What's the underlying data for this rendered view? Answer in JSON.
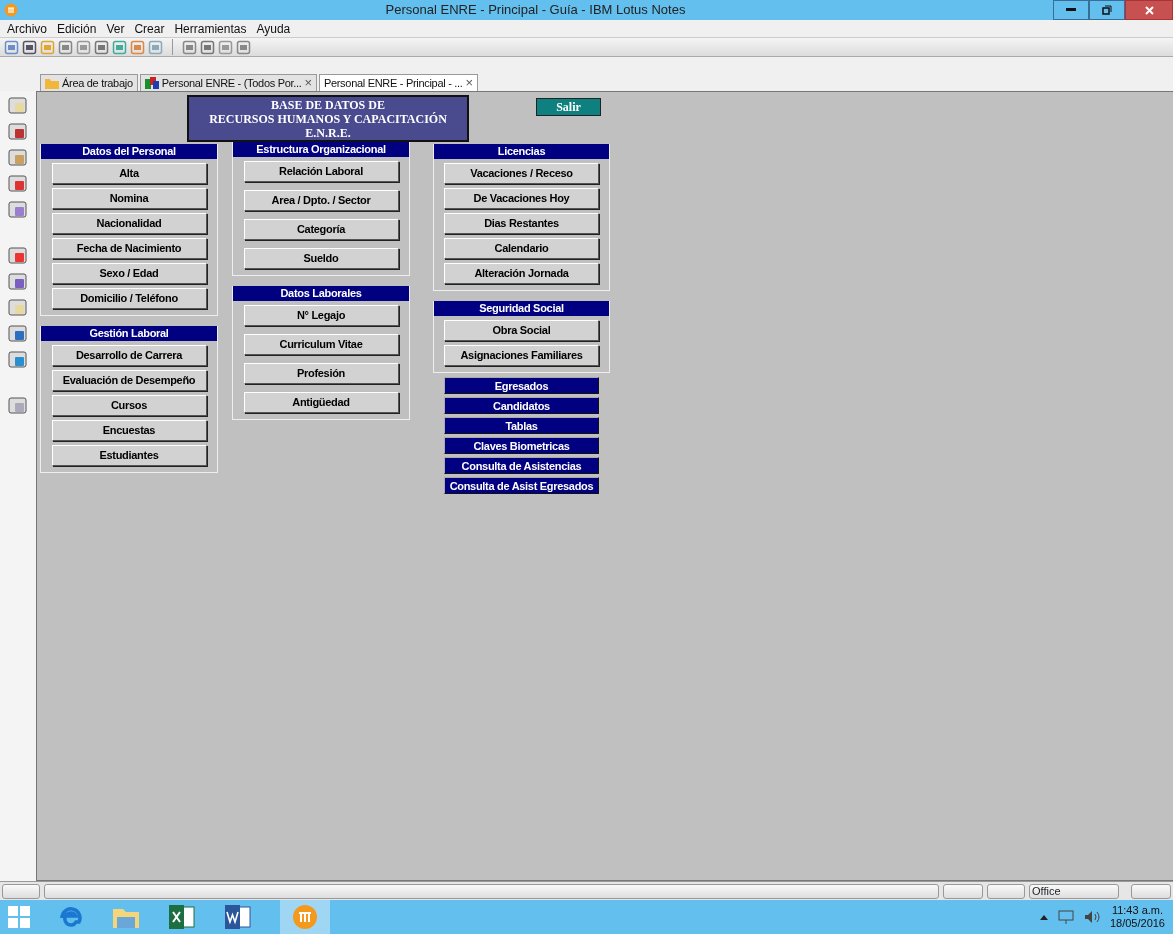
{
  "window": {
    "title": "Personal ENRE - Principal - Guía - IBM Lotus Notes"
  },
  "menu": [
    "Archivo",
    "Edición",
    "Ver",
    "Crear",
    "Herramientas",
    "Ayuda"
  ],
  "tabs": [
    {
      "label": "Área de trabajo",
      "selected": false
    },
    {
      "label": "Personal ENRE - (Todos Por...",
      "selected": false,
      "close": "×"
    },
    {
      "label": "Personal ENRE - Principal - ...",
      "selected": true,
      "close": "×"
    }
  ],
  "form": {
    "banner": [
      "BASE DE DATOS DE",
      "RECURSOS HUMANOS Y CAPACITACIÓN",
      "E.N.R.E."
    ],
    "exit_button": "Salir",
    "columns": [
      [
        {
          "kind": "panel",
          "title": "Datos del Personal",
          "buttons": [
            "Alta",
            "Nomina",
            "Nacionalidad",
            "Fecha de Nacimiento",
            "Sexo / Edad",
            "Domicilio / Teléfono"
          ]
        },
        {
          "kind": "panel",
          "title": "Gestión Laboral",
          "buttons": [
            "Desarrollo de Carrera",
            "Evaluación de Desempeño",
            "Cursos",
            "Encuestas",
            "Estudiantes"
          ]
        }
      ],
      [
        {
          "kind": "panel",
          "title": "Estructura Organizacional",
          "buttons": [
            "Relación Laboral",
            "Area / Dpto. / Sector",
            "Categoría",
            "Sueldo"
          ]
        },
        {
          "kind": "panel",
          "title": "Datos Laborales",
          "buttons": [
            "N° Legajo",
            "Curriculum Vitae",
            "Profesión",
            "Antigüedad"
          ]
        }
      ],
      [
        {
          "kind": "panel",
          "title": "Licencias",
          "buttons": [
            "Vacaciones / Receso",
            "De Vacaciones Hoy",
            "Dias Restantes",
            "Calendario",
            "Alteración Jornada"
          ]
        },
        {
          "kind": "panel",
          "title": "Seguridad Social",
          "buttons": [
            "Obra Social",
            "Asignaciones Familiares"
          ]
        },
        {
          "kind": "links",
          "buttons": [
            "Egresados",
            "Candidatos",
            "Tablas",
            "Claves Biometricas",
            "Consulta de Asistencias",
            "Consulta de Asist Egresados"
          ]
        }
      ]
    ]
  },
  "status_bar": {
    "location": "Office"
  },
  "taskbar": {
    "time": "11:43 a.m.",
    "date": "18/05/2016"
  }
}
